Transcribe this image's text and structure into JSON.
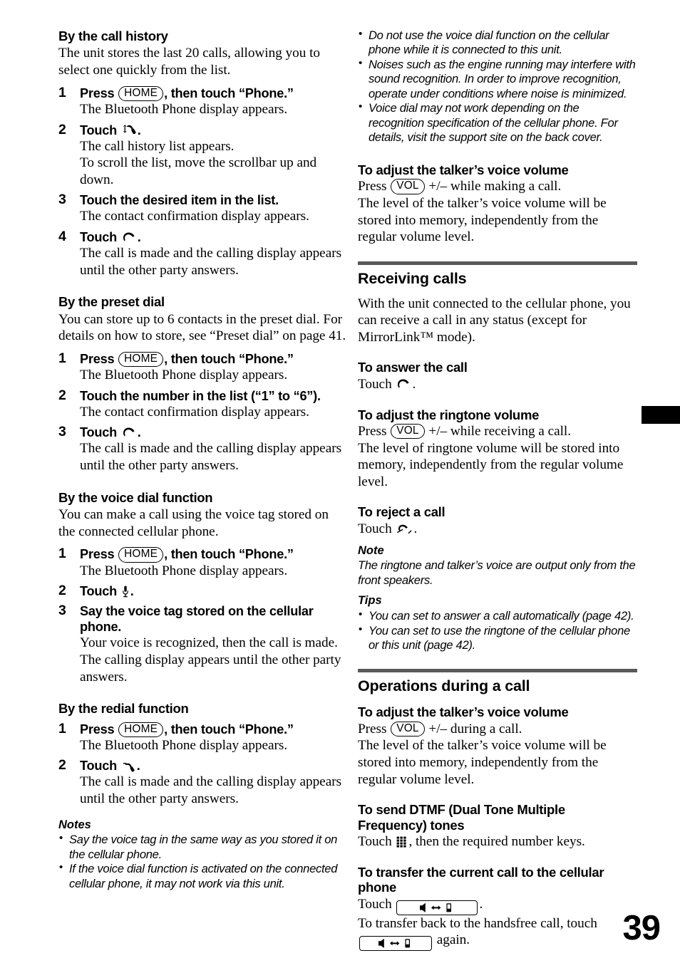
{
  "page": {
    "number": "39",
    "thumb_tab_color": "#000000",
    "rule_color": "#595959"
  },
  "left_column": {
    "call_history": {
      "heading": "By the call history",
      "intro": "The unit stores the last 20 calls, allowing you to select one quickly from the list.",
      "steps": [
        {
          "num": "1",
          "title_before": "Press ",
          "key": "HOME",
          "title_after": ", then touch “Phone.”",
          "body": "The Bluetooth Phone display appears."
        },
        {
          "num": "2",
          "title_before": "Touch ",
          "icon": "call-history-icon",
          "title_after": ".",
          "body": "The call history list appears.\nTo scroll the list, move the scrollbar up and down."
        },
        {
          "num": "3",
          "title_before": "Touch the desired item in the list.",
          "title_after": "",
          "body": "The contact confirmation display appears."
        },
        {
          "num": "4",
          "title_before": "Touch ",
          "icon": "handset-call-icon",
          "title_after": ".",
          "body": "The call is made and the calling display appears until the other party answers."
        }
      ]
    },
    "preset_dial": {
      "heading": "By the preset dial",
      "intro": "You can store up to 6 contacts in the preset dial. For details on how to store, see “Preset dial” on page 41.",
      "steps": [
        {
          "num": "1",
          "title_before": "Press ",
          "key": "HOME",
          "title_after": ", then touch “Phone.”",
          "body": "The Bluetooth Phone display appears."
        },
        {
          "num": "2",
          "title_before": "Touch the number in the list (“1” to “6”).",
          "title_after": "",
          "body": "The contact confirmation display appears."
        },
        {
          "num": "3",
          "title_before": "Touch ",
          "icon": "handset-call-icon",
          "title_after": ".",
          "body": "The call is made and the calling display appears until the other party answers."
        }
      ]
    },
    "voice_dial": {
      "heading": "By the voice dial function",
      "intro": "You can make a call using the voice tag stored on the connected cellular phone.",
      "steps": [
        {
          "num": "1",
          "title_before": "Press ",
          "key": "HOME",
          "title_after": ", then touch “Phone.”",
          "body": "The Bluetooth Phone display appears."
        },
        {
          "num": "2",
          "title_before": "Touch ",
          "icon": "microphone-icon",
          "title_after": ".",
          "body": ""
        },
        {
          "num": "3",
          "title_before": "Say the voice tag stored on the cellular phone.",
          "title_after": "",
          "body": "Your voice is recognized, then the call is made.\nThe calling display appears until the other party answers."
        }
      ]
    },
    "redial": {
      "heading": "By the redial function",
      "steps": [
        {
          "num": "1",
          "title_before": "Press ",
          "key": "HOME",
          "title_after": ", then touch “Phone.”",
          "body": "The Bluetooth Phone display appears."
        },
        {
          "num": "2",
          "title_before": "Touch ",
          "icon": "redial-icon",
          "title_after": ".",
          "body": "The call is made and the calling display appears until the other party answers."
        }
      ]
    },
    "notes": {
      "heading": "Notes",
      "items": [
        "Say the voice tag in the same way as you stored it on the cellular phone.",
        "If the voice dial function is activated on the connected cellular phone, it may not work via this unit."
      ]
    }
  },
  "right_column": {
    "continued_notes": {
      "items": [
        "Do not use the voice dial function on the cellular phone while it is connected to this unit.",
        "Noises such as the engine running may interfere with sound recognition. In order to improve recognition, operate under conditions where noise is minimized.",
        "Voice dial may not work depending on the recognition specification of the cellular phone. For details, visit the support site on the back cover."
      ]
    },
    "talker_volume_making": {
      "heading": "To adjust the talker’s voice volume",
      "press_before": "Press ",
      "key": "VOL",
      "press_after": " +/– while making a call.",
      "body": "The level of the talker’s voice volume will be stored into memory, independently from the regular volume level."
    },
    "receiving_calls": {
      "heading": "Receiving calls",
      "intro": "With the unit connected to the cellular phone, you can receive a call in any status (except for MirrorLink™ mode).",
      "answer": {
        "heading": "To answer the call",
        "touch_before": "Touch ",
        "icon": "handset-call-icon",
        "touch_after": "."
      },
      "ringtone_volume": {
        "heading": "To adjust the ringtone volume",
        "press_before": "Press ",
        "key": "VOL",
        "press_after": " +/– while receiving a call.",
        "body": "The level of ringtone volume will be stored into memory, independently from the regular volume level."
      },
      "reject": {
        "heading": "To reject a call",
        "touch_before": "Touch ",
        "icon": "handset-reject-icon",
        "touch_after": "."
      },
      "note": {
        "heading": "Note",
        "body": "The ringtone and talker’s voice are output only from the front speakers."
      },
      "tips": {
        "heading": "Tips",
        "items": [
          "You can set to answer a call automatically (page 42).",
          "You can set to use the ringtone of the cellular phone or this unit (page 42)."
        ]
      }
    },
    "operations_during_call": {
      "heading": "Operations during a call",
      "talker_volume": {
        "heading": "To adjust the talker’s voice volume",
        "press_before": "Press ",
        "key": "VOL",
        "press_after": " +/– during a call.",
        "body": "The level of the talker’s voice volume will be stored into memory, independently from the regular volume level."
      },
      "dtmf": {
        "heading": "To send DTMF (Dual Tone Multiple Frequency) tones",
        "touch_before": "Touch ",
        "icon": "keypad-icon",
        "touch_after": ", then the required number keys."
      },
      "transfer": {
        "heading": "To transfer the current call to the cellular phone",
        "touch_before": "Touch ",
        "button_icon": "speaker-to-phone-transfer-button",
        "touch_after": ".",
        "back_before": "To transfer back to the handsfree call, touch ",
        "back_after": " again."
      }
    }
  }
}
